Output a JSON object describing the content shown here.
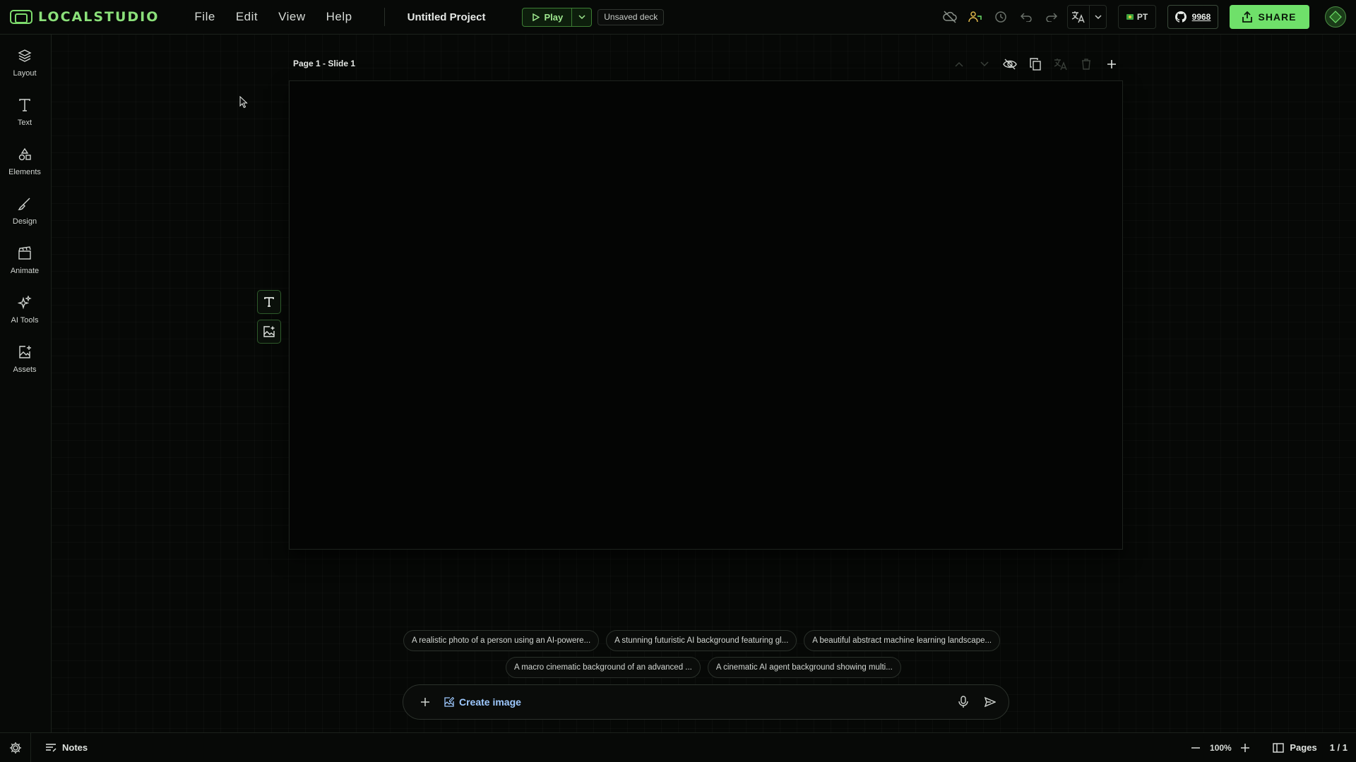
{
  "brand": {
    "name": "LOCALSTUDIO"
  },
  "menu": [
    "File",
    "Edit",
    "View",
    "Help"
  ],
  "project": {
    "title": "Untitled Project"
  },
  "play": {
    "label": "Play"
  },
  "deck_status": "Unsaved deck",
  "language": {
    "code": "PT"
  },
  "github": {
    "stars": "9968"
  },
  "share": {
    "label": "SHARE"
  },
  "sidebar": {
    "items": [
      {
        "label": "Layout",
        "icon": "layers-icon"
      },
      {
        "label": "Text",
        "icon": "text-icon"
      },
      {
        "label": "Elements",
        "icon": "shapes-icon"
      },
      {
        "label": "Design",
        "icon": "brush-icon"
      },
      {
        "label": "Animate",
        "icon": "clapperboard-icon"
      },
      {
        "label": "AI Tools",
        "icon": "sparkles-icon"
      },
      {
        "label": "Assets",
        "icon": "image-plus-icon"
      }
    ]
  },
  "slide": {
    "header": "Page 1 - Slide 1"
  },
  "suggestions": {
    "row1": [
      "A realistic photo of a person using an AI-powere...",
      "A stunning futuristic AI background featuring gl...",
      "A beautiful abstract machine learning landscape..."
    ],
    "row2": [
      "A macro cinematic background of an advanced ...",
      "A cinematic AI agent background showing multi..."
    ]
  },
  "prompt": {
    "mode_label": "Create image"
  },
  "bottom": {
    "notes_label": "Notes",
    "zoom": "100%",
    "pages_label": "Pages",
    "page_count": "1 / 1"
  },
  "colors": {
    "accent": "#6fe06a",
    "brand_text": "#8be07a",
    "link": "#9ec9ff",
    "background": "#060806"
  }
}
